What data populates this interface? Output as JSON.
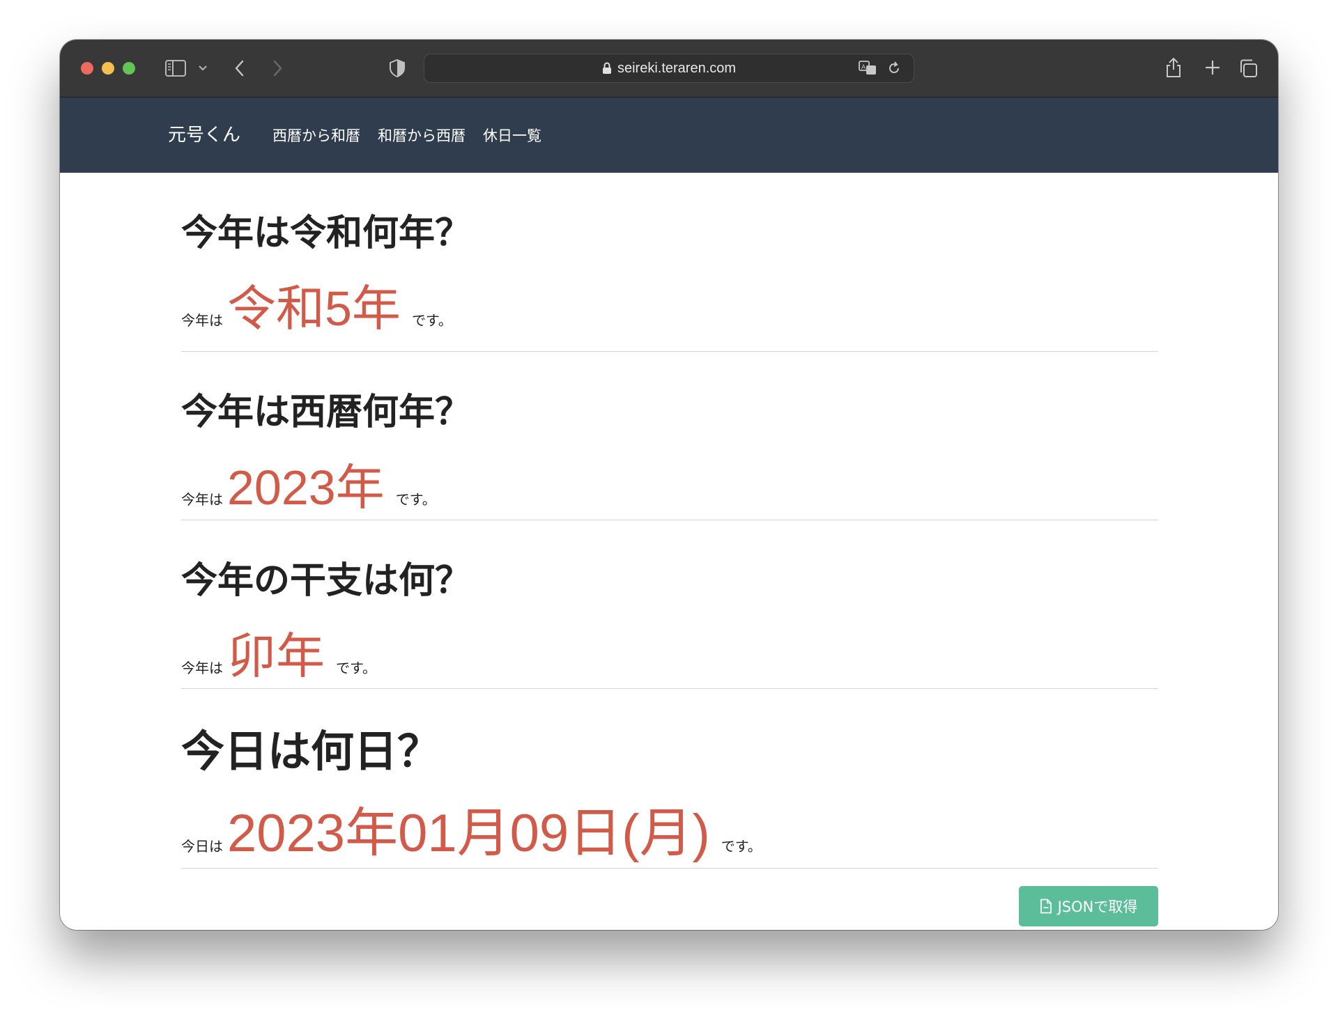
{
  "browser": {
    "url": "seireki.teraren.com"
  },
  "navbar": {
    "brand": "元号くん",
    "links": [
      {
        "label": "西暦から和暦"
      },
      {
        "label": "和暦から西暦"
      },
      {
        "label": "休日一覧"
      }
    ]
  },
  "sections": [
    {
      "question": "今年は令和何年？",
      "prefix": "今年は",
      "answer": "令和5年",
      "suffix": "です。"
    },
    {
      "question": "今年は西暦何年？",
      "prefix": "今年は",
      "answer": "2023年",
      "suffix": "です。"
    },
    {
      "question": "今年の干支は何？",
      "prefix": "今年は",
      "answer": "卯年",
      "suffix": "です。"
    },
    {
      "question": "今日は何日？",
      "prefix": "今日は",
      "answer": "2023年01月09日(月)",
      "suffix": "です。"
    }
  ],
  "json_button": {
    "label": "JSONで取得"
  },
  "colors": {
    "navbar_bg": "#2f3d4e",
    "answer": "#d25a48",
    "button_bg": "#5bbd9a"
  }
}
